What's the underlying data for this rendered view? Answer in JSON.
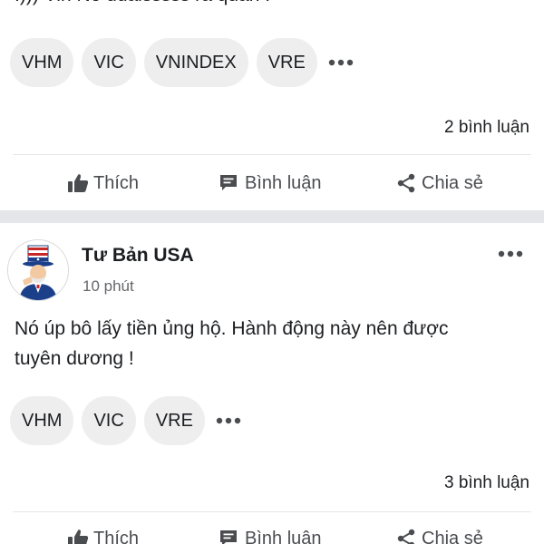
{
  "post1": {
    "text": ".))) Vin Nó ddaisssss rà quần !",
    "tags": [
      "VHM",
      "VIC",
      "VNINDEX",
      "VRE"
    ],
    "more_icon": "more-horizontal-icon",
    "comment_count": "2 bình luận",
    "actions": {
      "like": "Thích",
      "comment": "Bình luận",
      "share": "Chia sẻ"
    }
  },
  "post2": {
    "author": "Tư Bản USA",
    "avatar": "uncle-sam-avatar",
    "time": "10 phút",
    "menu_icon": "more-horizontal-icon",
    "text": "Nó úp bô lấy tiền ủng hộ. Hành động này nên được\ntuyên dương !",
    "tags": [
      "VHM",
      "VIC",
      "VRE"
    ],
    "more_icon": "more-horizontal-icon",
    "comment_count": "3 bình luận",
    "actions": {
      "like": "Thích",
      "comment": "Bình luận",
      "share": "Chia sẻ"
    }
  },
  "colors": {
    "tag_background": "#eeeeef",
    "separator": "#e4e6e9",
    "action_text": "#4a4c50",
    "secondary_text": "#65676b"
  }
}
